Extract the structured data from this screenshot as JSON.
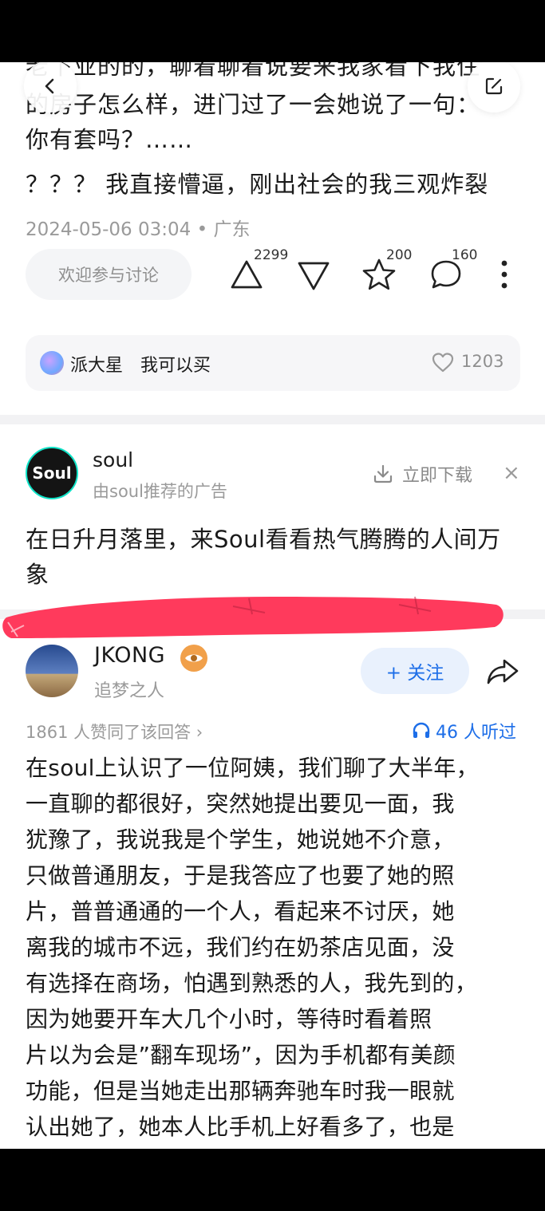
{
  "post": {
    "cut_line": "老下业的的，聊着聊着说要来我家看下我住",
    "lines": [
      "的房子怎么样，进门过了一会她说了一句：",
      "你有套吗？……",
      "？？？ 我直接懵逼，刚出社会的我三观炸裂"
    ],
    "meta": "2024-05-06 03:04 • 广东",
    "discuss_placeholder": "欢迎参与讨论",
    "upvotes": "2299",
    "favorites": "200",
    "comments": "160"
  },
  "reply": {
    "name": "派大星",
    "text": "我可以买",
    "likes": "1203"
  },
  "ad": {
    "logo_text": "Soul",
    "name": "soul",
    "sub": "由soul推荐的广告",
    "download_label": "立即下载",
    "close_label": "×",
    "body": "在日升月落里，来Soul看看热气腾腾的人间万象"
  },
  "answer": {
    "author_name": "JKONG",
    "author_sub": "追梦之人",
    "follow_label": "+ 关注",
    "agree_text": "1861 人赞同了该回答 ›",
    "listen_text": "46 人听过",
    "lines": [
      "在soul上认识了一位阿姨，我们聊了大半年，",
      "一直聊的都很好，突然她提出要见一面，我",
      "犹豫了，我说我是个学生，她说她不介意，",
      "只做普通朋友，于是我答应了也要了她的照",
      "片，普普通通的一个人，看起来不讨厌，她",
      "离我的城市不远，我们约在奶茶店见面，没",
      "有选择在商场，怕遇到熟悉的人，我先到的，",
      "因为她要开车大几个小时，等待时看着照",
      "片以为会是”翻车现场”，因为手机都有美颜",
      "功能，但是当她走出那辆奔驰车时我一眼就",
      "认出她了，她本人比手机上好看多了，也是"
    ]
  },
  "colors": {
    "accent_blue": "#1d6ee8",
    "scribble_red": "#ff3a5c"
  }
}
